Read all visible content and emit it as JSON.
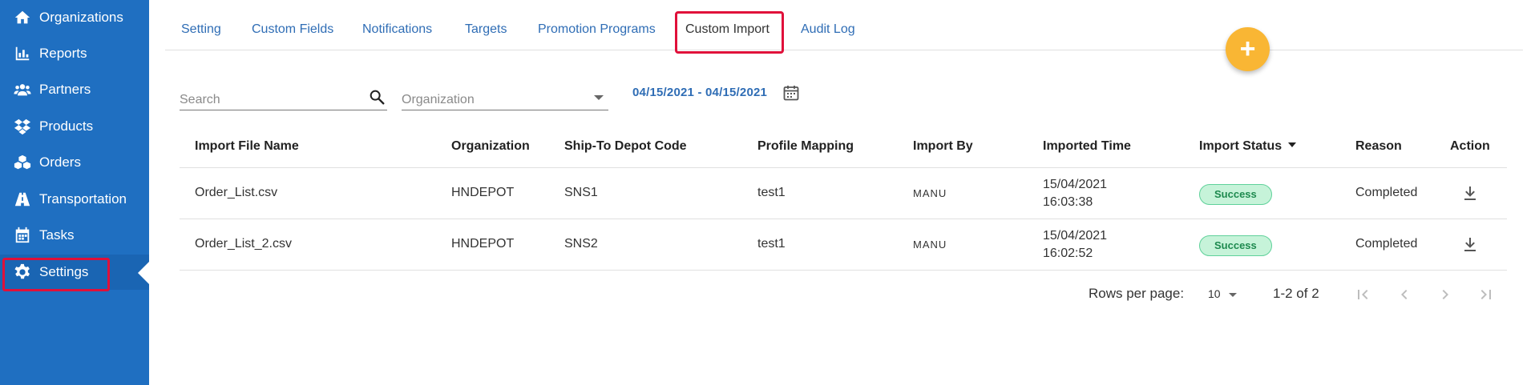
{
  "sidebar": {
    "items": [
      {
        "label": "Organizations",
        "icon": "home-icon"
      },
      {
        "label": "Reports",
        "icon": "bar-chart-icon"
      },
      {
        "label": "Partners",
        "icon": "users-icon"
      },
      {
        "label": "Products",
        "icon": "dropbox-icon"
      },
      {
        "label": "Orders",
        "icon": "cubes-icon"
      },
      {
        "label": "Transportation",
        "icon": "road-icon"
      },
      {
        "label": "Tasks",
        "icon": "calendar-icon"
      },
      {
        "label": "Settings",
        "icon": "gear-icon"
      }
    ],
    "active": "Settings"
  },
  "tabs": {
    "items": [
      "Setting",
      "Custom Fields",
      "Notifications",
      "Targets",
      "Promotion Programs",
      "Custom Import",
      "Audit Log"
    ],
    "active": "Custom Import"
  },
  "fab": {
    "label": "+"
  },
  "filters": {
    "search_placeholder": "Search",
    "organization_placeholder": "Organization",
    "date_range": "04/15/2021 - 04/15/2021"
  },
  "table": {
    "columns": [
      "Import File Name",
      "Organization",
      "Ship-To Depot Code",
      "Profile Mapping",
      "Import By",
      "Imported Time",
      "Import Status",
      "Reason",
      "Action"
    ],
    "rows": [
      {
        "file": "Order_List.csv",
        "org": "HNDEPOT",
        "depot": "SNS1",
        "profile": "test1",
        "by": "MANU",
        "date": "15/04/2021",
        "time": "16:03:38",
        "status": "Success",
        "reason": "Completed"
      },
      {
        "file": "Order_List_2.csv",
        "org": "HNDEPOT",
        "depot": "SNS2",
        "profile": "test1",
        "by": "MANU",
        "date": "15/04/2021",
        "time": "16:02:52",
        "status": "Success",
        "reason": "Completed"
      }
    ]
  },
  "pagination": {
    "rows_per_page_label": "Rows per page:",
    "rows_per_page": "10",
    "range": "1-2 of 2"
  },
  "colors": {
    "sidebar": "#1f6fc1",
    "link": "#2f6db5",
    "highlight": "#e0103a",
    "fab": "#f9b634",
    "success_bg": "#c6f3d9",
    "success_text": "#1e8a4f"
  }
}
